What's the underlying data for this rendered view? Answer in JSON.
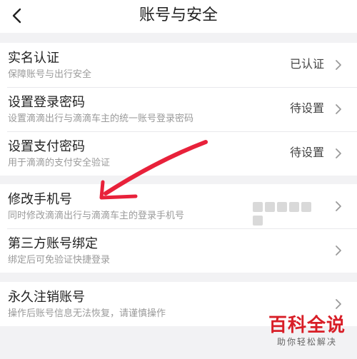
{
  "header": {
    "title": "账号与安全"
  },
  "groups": [
    {
      "rows": [
        {
          "title": "实名认证",
          "subtitle": "保障账号与出行安全",
          "value": "已认证"
        },
        {
          "title": "设置登录密码",
          "subtitle": "设置滴滴出行与滴滴车主的统一账号登录密码",
          "value": "待设置"
        },
        {
          "title": "设置支付密码",
          "subtitle": "用于滴滴的支付安全验证",
          "value": "待设置"
        }
      ]
    },
    {
      "rows": [
        {
          "title": "修改手机号",
          "subtitle": "同时修改滴滴出行与滴滴车主的登录手机号",
          "value": ""
        },
        {
          "title": "第三方账号绑定",
          "subtitle": "绑定后可免验证快捷登录",
          "value": ""
        }
      ]
    },
    {
      "rows": [
        {
          "title": "永久注销账号",
          "subtitle": "操作后账号信息无法恢复，请谨慎操作",
          "value": ""
        }
      ]
    }
  ],
  "watermark": {
    "main": "百科全说",
    "sub": "助你轻松解决"
  },
  "colors": {
    "annotation_arrow": "#e8213a",
    "watermark_red": "#d81e27"
  }
}
